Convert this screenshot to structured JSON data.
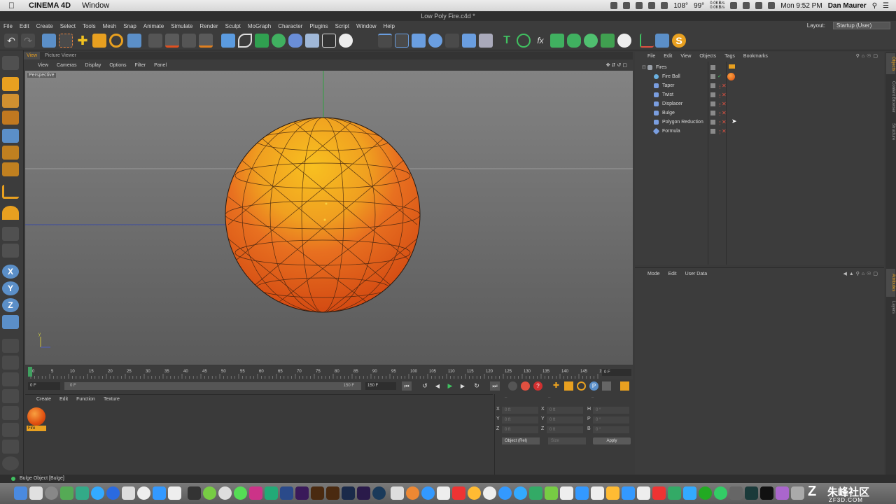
{
  "mac_menubar": {
    "app_name": "CINEMA 4D",
    "window_menu": "Window",
    "temp": "108°",
    "percent": "99°",
    "net_up": "0.0KB/s",
    "net_down": "0.0KB/s",
    "clock": "Mon 9:52 PM",
    "user": "Dan Maurer"
  },
  "title": "Low Poly Fire.c4d *",
  "menu": [
    "File",
    "Edit",
    "Create",
    "Select",
    "Tools",
    "Mesh",
    "Snap",
    "Animate",
    "Simulate",
    "Render",
    "Sculpt",
    "MoGraph",
    "Character",
    "Plugins",
    "Script",
    "Window",
    "Help"
  ],
  "layout": {
    "label": "Layout:",
    "value": "Startup (User)"
  },
  "viewport": {
    "tabs": [
      "View",
      "Picture Viewer"
    ],
    "menu": [
      "View",
      "Cameras",
      "Display",
      "Options",
      "Filter",
      "Panel"
    ],
    "label": "Perspective"
  },
  "timeline": {
    "ticks": [
      "0",
      "5",
      "10",
      "15",
      "20",
      "25",
      "30",
      "35",
      "40",
      "45",
      "50",
      "55",
      "60",
      "65",
      "70",
      "75",
      "80",
      "85",
      "90",
      "95",
      "100",
      "105",
      "110",
      "115",
      "120",
      "125",
      "130",
      "135",
      "140",
      "145",
      "150"
    ],
    "current_frame": "0 F"
  },
  "transport": {
    "start": "0 F",
    "slider_start": "0 F",
    "slider_end": "150 F",
    "end": "150 F"
  },
  "material_manager": {
    "menu": [
      "Create",
      "Edit",
      "Function",
      "Texture"
    ],
    "material_name": "Fire"
  },
  "coordinates": {
    "rows": [
      {
        "a": "X",
        "av": "0 ft",
        "b": "X",
        "bv": "0 ft",
        "c": "H",
        "cv": "0 °"
      },
      {
        "a": "Y",
        "av": "0 ft",
        "b": "Y",
        "bv": "0 ft",
        "c": "P",
        "cv": "0 °"
      },
      {
        "a": "Z",
        "av": "0 ft",
        "b": "Z",
        "bv": "0 ft",
        "c": "B",
        "cv": "0 °"
      }
    ],
    "mode": "Object (Rel)",
    "size": "Size",
    "apply": "Apply"
  },
  "object_manager": {
    "menu": [
      "File",
      "Edit",
      "View",
      "Objects",
      "Tags",
      "Bookmarks"
    ],
    "objects": [
      {
        "name": "Fires",
        "icon_color": "#9aa0a8"
      },
      {
        "name": "Fire Ball",
        "icon_color": "#6ab0e0"
      },
      {
        "name": "Taper",
        "icon_color": "#7a9ee0"
      },
      {
        "name": "Twist",
        "icon_color": "#7a9ee0"
      },
      {
        "name": "Displacer",
        "icon_color": "#7a9ee0"
      },
      {
        "name": "Bulge",
        "icon_color": "#7a9ee0"
      },
      {
        "name": "Polygon Reduction",
        "icon_color": "#7a9ee0"
      },
      {
        "name": "Formula",
        "icon_color": "#7a9ee0"
      }
    ]
  },
  "attribute_manager": {
    "menu": [
      "Mode",
      "Edit",
      "User Data"
    ]
  },
  "right_tabs": [
    "Objects",
    "Content Browser",
    "Structure",
    "Attributes",
    "Layers"
  ],
  "status": "Bulge Object [Bulge]",
  "watermark": {
    "text1": "朱峰社区",
    "text2": "ZF3D.COM"
  }
}
